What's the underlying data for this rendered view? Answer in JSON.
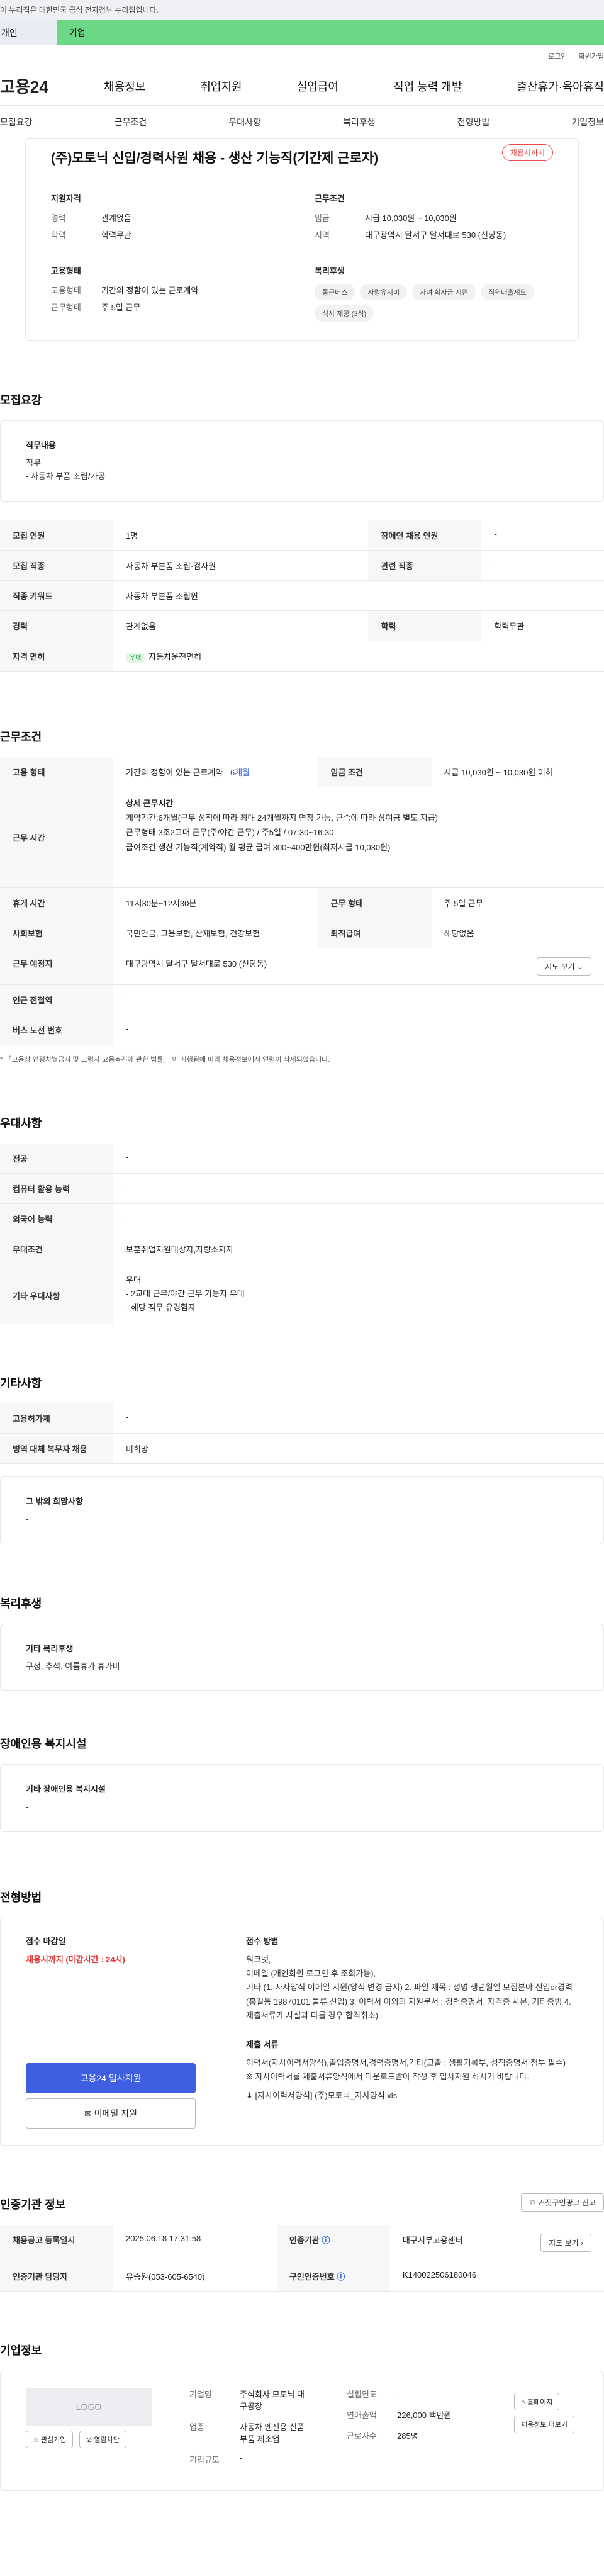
{
  "banner": "이 누리집은 대한민국 공식 전자정부 누리집입니다.",
  "tabs": [
    "개인",
    "기업"
  ],
  "util": [
    "로그인",
    "회원가입"
  ],
  "logo": "고용24",
  "gnb": [
    "채용정보",
    "취업지원",
    "실업급여",
    "직업 능력 개발",
    "출산휴가·육아휴직"
  ],
  "subnav": [
    "모집요강",
    "근무조건",
    "우대사항",
    "복리후생",
    "전형방법",
    "기업정보"
  ],
  "job": {
    "title": "(주)모토닉 신입/경력사원 채용 - 생산 기능직(기간제 근로자)",
    "status": "채용시까지",
    "qual_title": "지원자격",
    "qual": [
      {
        "k": "경력",
        "v": "관계없음"
      },
      {
        "k": "학력",
        "v": "학력무관"
      }
    ],
    "cond_title": "근무조건",
    "cond": [
      {
        "k": "임금",
        "v": "시급 10,030원 ~ 10,030원"
      },
      {
        "k": "지역",
        "v": "대구광역시 달서구 달서대로 530 (신당동)"
      }
    ],
    "emp_title": "고용형태",
    "emp": [
      {
        "k": "고용형태",
        "v": "기간의 정함이 있는 근로계약"
      },
      {
        "k": "근무형태",
        "v": "주 5일 근무"
      }
    ],
    "welfare_title": "복리후생",
    "welfare_tags": [
      "통근버스",
      "자랑유지비",
      "자녀 학자금 지원",
      "직원대출제도",
      "식사 제공 (3식)"
    ]
  },
  "recruit": {
    "section": "모집요강",
    "duty_title": "직무내용",
    "duty": "직무\n - 자동차 부품 조립/가공",
    "rows": [
      {
        "k1": "모집 인원",
        "v1": "1명",
        "k2": "장애인 채용 인원",
        "v2": "-"
      },
      {
        "k1": "모집 직종",
        "v1": "자동차 부분품 조립·검사원",
        "k2": "관련 직종",
        "v2": "-"
      },
      {
        "k1": "직종 키워드",
        "v1": "자동차 부분품 조립원",
        "k2": "",
        "v2": ""
      },
      {
        "k1": "경력",
        "v1": "관계없음",
        "k2": "학력",
        "v2": "학력무관"
      },
      {
        "k1": "자격 면허",
        "v1": "자동차운전면허",
        "k2": "",
        "v2": ""
      }
    ],
    "license_badge": "우대"
  },
  "work": {
    "section": "근무조건",
    "emp_type_k": "고용 형태",
    "emp_type_v": "기간의 정함이 있는 근로계약 -",
    "emp_type_months": "6개월",
    "wage_k": "임금 조건",
    "wage_v": "시급 10,030원 ~ 10,030원 이하",
    "hours_k": "근무 시간",
    "hours_title": "상세 근무시간",
    "hours_lines": [
      "계약기간:6개월(근무 성적에 따라 최대 24개월까지 연장 가능, 근속에 따라 상여금 별도 지급)",
      "근무형태:3조2교대 근무(주/야간 근무) / 주5일 / 07:30~16:30",
      "급여조건:생산 기능직(계약직) 월 평균 급여 300~400만원(최저시급 10,030원)"
    ],
    "rows": [
      {
        "k1": "휴게 시간",
        "v1": "11시30분~12시30분",
        "k2": "근무 형태",
        "v2": "주 5일 근무"
      },
      {
        "k1": "사회보험",
        "v1": "국민연금, 고용보험, 산재보험, 건강보험",
        "k2": "퇴직급여",
        "v2": "해당없음"
      }
    ],
    "loc_k": "근무 예정지",
    "loc_v": "대구광역시 달서구 달서대로 530 (신당동)",
    "map_btn": "지도 보기",
    "subway_k": "인근 전철역",
    "subway_v": "-",
    "bus_k": "버스 노선 번호",
    "bus_v": "-",
    "note": "* 「고용상 연령차별금지 및 고령자 고용촉진에 관한 법률」 이 시행됨에 따라 채용정보에서 연령이 삭제되었습니다."
  },
  "pref": {
    "section": "우대사항",
    "rows": [
      {
        "k": "전공",
        "v": "-"
      },
      {
        "k": "컴퓨터 활용 능력",
        "v": "-"
      },
      {
        "k": "외국어 능력",
        "v": "-"
      },
      {
        "k": "우대조건",
        "v": "보훈취업지원대상자,자랑소지자"
      }
    ],
    "etc_k": "기타 우대사항",
    "etc_lines": [
      "우대",
      "- 2교대 근무/야간 근무 가능자 우대",
      "- 해당 직무 유경험자"
    ]
  },
  "other": {
    "section": "기타사항",
    "rows": [
      {
        "k": "고용허가제",
        "v": "-"
      },
      {
        "k": "병역 대체 복무자 채용",
        "v": "비희망"
      }
    ],
    "hope_title": "그 밖의 희망사항",
    "hope": "-"
  },
  "welfare": {
    "section": "복리후생",
    "title": "기타 복리후생",
    "text": "구정, 추석, 여름휴가 휴가비"
  },
  "disab": {
    "section": "장애인용 복지시설",
    "title": "기타 장애인용 복지시설",
    "text": "-"
  },
  "apply": {
    "section": "전형방법",
    "deadline_title": "접수 마감일",
    "deadline": "채용시까지 (마감시간 : 24시)",
    "method_title": "접수 방법",
    "method_lines": [
      "워크넷,",
      "이메일 (개인회원 로그인 후 조회가능),",
      "기타 (1. 자사양식 이메일 지원(양식 변경 금지) 2. 파일 제목 : 성명 생년월일 모집분야 신입or경력(홍길동 19870101 물류 신입) 3. 이력서 이외의 지원문서 : 경력증명서, 자격증 사본, 기타증빙 4. 제출서류가 사실과 다를 경우 합격취소)"
    ],
    "docs_title": "제출 서류",
    "docs_lines": [
      "이력서(자사이력서양식),졸업증명서,경력증명서,기타(고졸 : 생활기록부, 성적증명서 첨부 필수)",
      "※ 자사이력서를 제출서류양식에서 다운로드받아 작성 후 입사지원 하시기 바랍니다."
    ],
    "file": "[자사이력서양식] (주)모토닉_자사양식.xls",
    "apply_btn": "고용24 입사지원",
    "mail_btn": "이메일 지원"
  },
  "agency": {
    "section": "인증기관 정보",
    "report_btn": "거짓구인광고 신고",
    "reg_k": "채용공고 등록일시",
    "reg_v": "2025.06.18 17:31:58",
    "org_k": "인증기관",
    "org_v": "대구서부고용센터",
    "map_btn": "지도 보기",
    "manager_k": "인증기관 담당자",
    "manager_v": "유승원(053-605-6540)",
    "no_k": "구인인증번호",
    "no_v": "K140022506180046"
  },
  "company": {
    "section": "기업정보",
    "logo": "LOGO",
    "fav_btn": "관심기업",
    "block_btn": "열람차단",
    "name_k": "기업명",
    "name_v": "주식회사 모토닉 대구공장",
    "industry_k": "업종",
    "industry_v": "자동차 엔진용 신품 부품 제조업",
    "size_k": "기업규모",
    "size_v": "-",
    "est_k": "설립연도",
    "est_v": "-",
    "sales_k": "연매출액",
    "sales_v": "226,000 백만원",
    "emp_k": "근로자수",
    "emp_v": "285명",
    "home_btn": "홈페이지",
    "list_btn": "채용정보 더보기"
  }
}
